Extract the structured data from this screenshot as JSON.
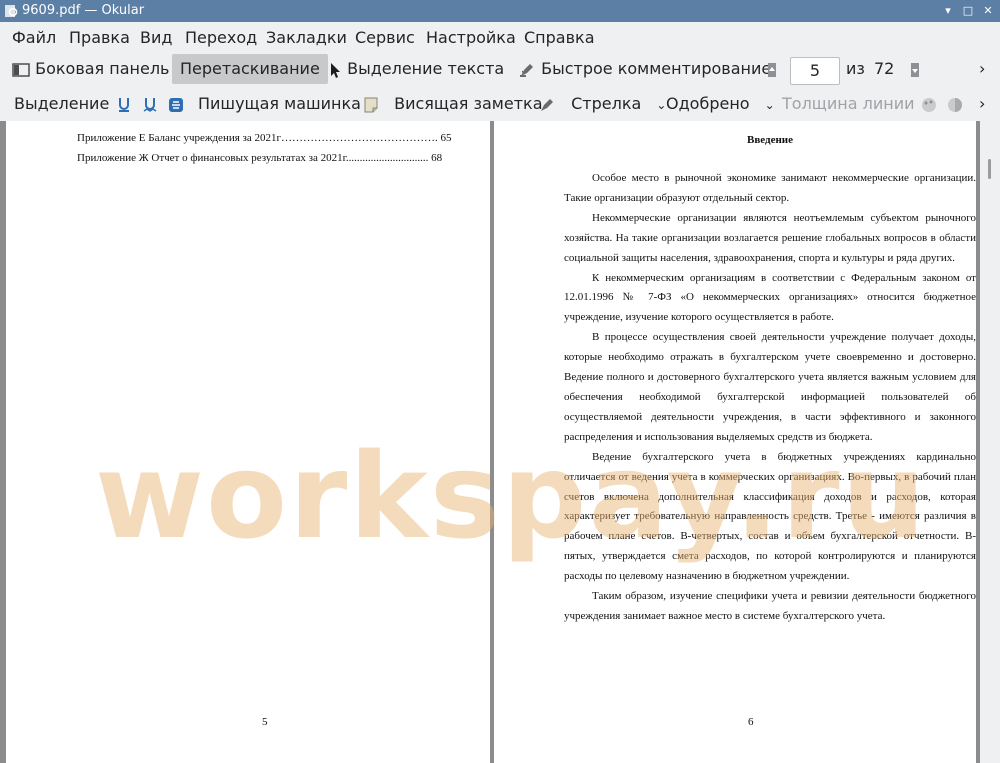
{
  "window": {
    "title": "9609.pdf  — Okular"
  },
  "menu": [
    "Файл",
    "Правка",
    "Вид",
    "Переход",
    "Закладки",
    "Сервис",
    "Настройка",
    "Справка"
  ],
  "toolbar1": {
    "sidebar": "Боковая панель",
    "drag": "Перетаскивание",
    "text_select": "Выделение текста",
    "quick_comment": "Быстрое комментирование",
    "page_current": "5",
    "page_of": "из",
    "page_total": "72"
  },
  "toolbar2": {
    "highlight": "Выделение",
    "typewriter": "Пишущая машинка",
    "sticky_note": "Висящая заметка",
    "arrow": "Стрелка",
    "stamp": "Одобрено",
    "line_width": "Толщина линии"
  },
  "left_page": {
    "toc": [
      {
        "text": "Приложение Е Баланс учреждения за 2021г……………………………………. 65"
      },
      {
        "text": "Приложение Ж Отчет о финансовых результатах за 2021г.............................. 68"
      }
    ],
    "page_number": "5"
  },
  "right_page": {
    "heading": "Введение",
    "paragraphs": [
      "Особое место в рыночной экономике занимают некоммерческие организации. Такие организации образуют отдельный сектор.",
      "Некоммерческие организации являются неотъемлемым субъектом рыночного хозяйства. На такие организации возлагается решение глобальных вопросов в области социальной защиты населения, здравоохранения, спорта и культуры и ряда других.",
      "К некоммерческим организациям в соответствии с Федеральным законом от 12.01.1996 № 7-ФЗ «О некоммерческих организациях» относится бюджетное учреждение, изучение которого осуществляется в работе.",
      "В процессе осуществления своей деятельности учреждение получает доходы, которые необходимо отражать в бухгалтерском учете своевременно и достоверно. Ведение полного и достоверного бухгалтерского учета является важным условием для обеспечения необходимой бухгалтерской информацией пользователей об осуществляемой деятельности учреждения, в части эффективного и законного распределения и использования выделяемых средств из бюджета.",
      "Ведение бухгалтерского учета в бюджетных учреждениях кардинально отличается от ведения учета в коммерческих организациях. Во-первых, в рабочий план счетов включена дополнительная классификация доходов и расходов, которая характеризует требовательную направленность средств. Третье - имеются различия в рабочем плане счетов. В-четвертых, состав и объем бухгалтерской отчетности. В-пятых, утверждается смета расходов, по которой контролируются и планируются расходы по целевому назначению в бюджетном учреждении.",
      "Таким образом, изучение специфики учета и ревизии деятельности бюджетного учреждения занимает важное место в системе бухгалтерского учета."
    ],
    "page_number": "6"
  },
  "watermark": "workspay.ru"
}
